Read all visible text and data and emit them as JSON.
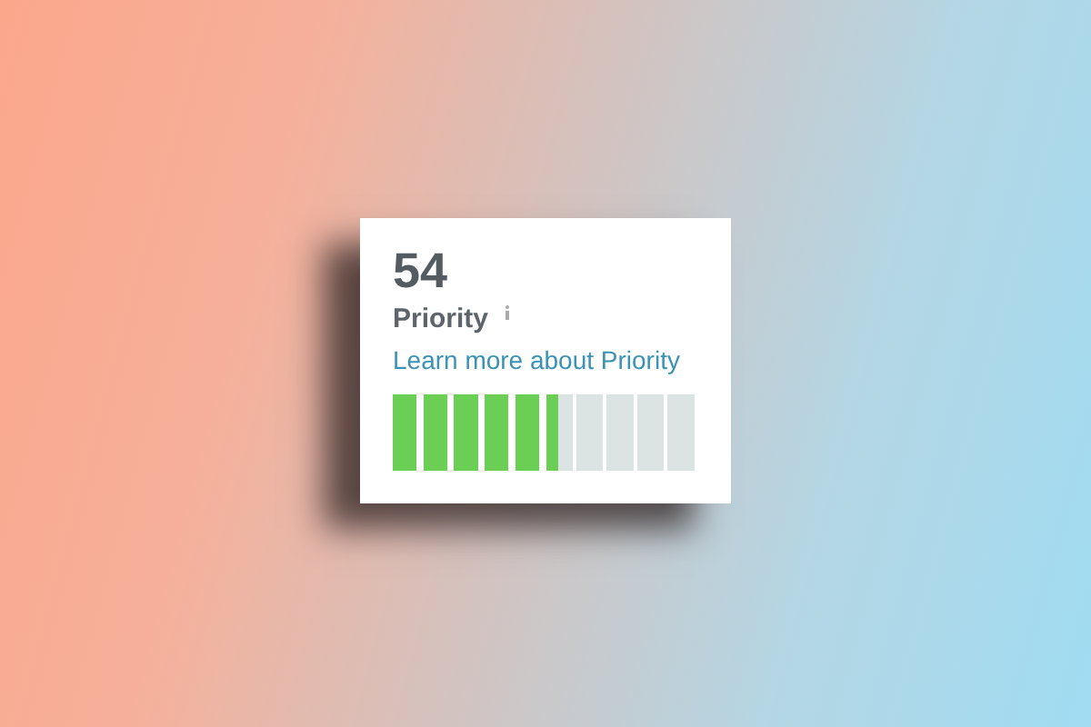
{
  "score": "54",
  "label": "Priority",
  "link": "Learn more about Priority",
  "meter": {
    "level": 0.54
  }
}
